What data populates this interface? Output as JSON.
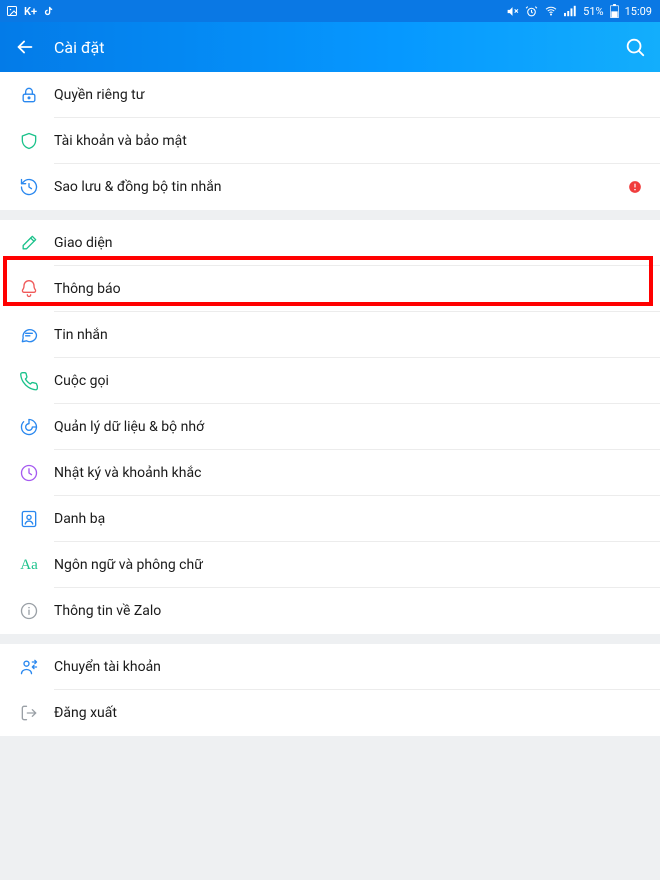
{
  "status": {
    "left_labels": {
      "kplus": "K+"
    },
    "right": {
      "battery_text": "51%",
      "time": "15:09"
    }
  },
  "header": {
    "title": "Cài đặt"
  },
  "rows": {
    "privacy": "Quyền riêng tư",
    "account": "Tài khoản và bảo mật",
    "backup": "Sao lưu & đồng bộ tin nhắn",
    "interface": "Giao diện",
    "notifications": "Thông báo",
    "messages": "Tin nhắn",
    "calls": "Cuộc gọi",
    "data": "Quản lý dữ liệu & bộ nhớ",
    "diary": "Nhật ký và khoảnh khắc",
    "contacts": "Danh bạ",
    "language": "Ngôn ngữ và phông chữ",
    "about": "Thông tin về Zalo",
    "switch": "Chuyển tài khoản",
    "logout": "Đăng xuất"
  },
  "highlight": {
    "target": "notifications"
  }
}
